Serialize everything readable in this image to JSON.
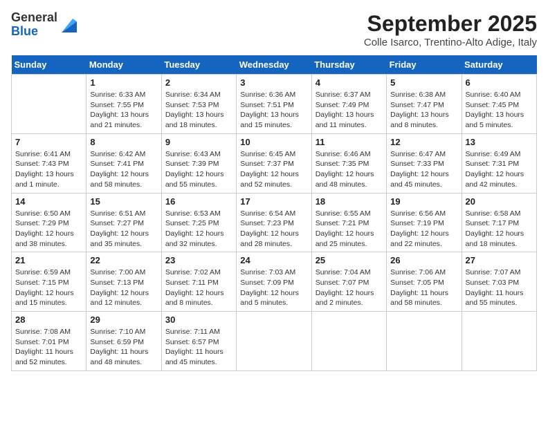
{
  "header": {
    "logo": {
      "general": "General",
      "blue": "Blue"
    },
    "title": "September 2025",
    "location": "Colle Isarco, Trentino-Alto Adige, Italy"
  },
  "calendar": {
    "weekdays": [
      "Sunday",
      "Monday",
      "Tuesday",
      "Wednesday",
      "Thursday",
      "Friday",
      "Saturday"
    ],
    "weeks": [
      [
        {
          "day": "",
          "sunrise": "",
          "sunset": "",
          "daylight": ""
        },
        {
          "day": "1",
          "sunrise": "Sunrise: 6:33 AM",
          "sunset": "Sunset: 7:55 PM",
          "daylight": "Daylight: 13 hours and 21 minutes."
        },
        {
          "day": "2",
          "sunrise": "Sunrise: 6:34 AM",
          "sunset": "Sunset: 7:53 PM",
          "daylight": "Daylight: 13 hours and 18 minutes."
        },
        {
          "day": "3",
          "sunrise": "Sunrise: 6:36 AM",
          "sunset": "Sunset: 7:51 PM",
          "daylight": "Daylight: 13 hours and 15 minutes."
        },
        {
          "day": "4",
          "sunrise": "Sunrise: 6:37 AM",
          "sunset": "Sunset: 7:49 PM",
          "daylight": "Daylight: 13 hours and 11 minutes."
        },
        {
          "day": "5",
          "sunrise": "Sunrise: 6:38 AM",
          "sunset": "Sunset: 7:47 PM",
          "daylight": "Daylight: 13 hours and 8 minutes."
        },
        {
          "day": "6",
          "sunrise": "Sunrise: 6:40 AM",
          "sunset": "Sunset: 7:45 PM",
          "daylight": "Daylight: 13 hours and 5 minutes."
        }
      ],
      [
        {
          "day": "7",
          "sunrise": "Sunrise: 6:41 AM",
          "sunset": "Sunset: 7:43 PM",
          "daylight": "Daylight: 13 hours and 1 minute."
        },
        {
          "day": "8",
          "sunrise": "Sunrise: 6:42 AM",
          "sunset": "Sunset: 7:41 PM",
          "daylight": "Daylight: 12 hours and 58 minutes."
        },
        {
          "day": "9",
          "sunrise": "Sunrise: 6:43 AM",
          "sunset": "Sunset: 7:39 PM",
          "daylight": "Daylight: 12 hours and 55 minutes."
        },
        {
          "day": "10",
          "sunrise": "Sunrise: 6:45 AM",
          "sunset": "Sunset: 7:37 PM",
          "daylight": "Daylight: 12 hours and 52 minutes."
        },
        {
          "day": "11",
          "sunrise": "Sunrise: 6:46 AM",
          "sunset": "Sunset: 7:35 PM",
          "daylight": "Daylight: 12 hours and 48 minutes."
        },
        {
          "day": "12",
          "sunrise": "Sunrise: 6:47 AM",
          "sunset": "Sunset: 7:33 PM",
          "daylight": "Daylight: 12 hours and 45 minutes."
        },
        {
          "day": "13",
          "sunrise": "Sunrise: 6:49 AM",
          "sunset": "Sunset: 7:31 PM",
          "daylight": "Daylight: 12 hours and 42 minutes."
        }
      ],
      [
        {
          "day": "14",
          "sunrise": "Sunrise: 6:50 AM",
          "sunset": "Sunset: 7:29 PM",
          "daylight": "Daylight: 12 hours and 38 minutes."
        },
        {
          "day": "15",
          "sunrise": "Sunrise: 6:51 AM",
          "sunset": "Sunset: 7:27 PM",
          "daylight": "Daylight: 12 hours and 35 minutes."
        },
        {
          "day": "16",
          "sunrise": "Sunrise: 6:53 AM",
          "sunset": "Sunset: 7:25 PM",
          "daylight": "Daylight: 12 hours and 32 minutes."
        },
        {
          "day": "17",
          "sunrise": "Sunrise: 6:54 AM",
          "sunset": "Sunset: 7:23 PM",
          "daylight": "Daylight: 12 hours and 28 minutes."
        },
        {
          "day": "18",
          "sunrise": "Sunrise: 6:55 AM",
          "sunset": "Sunset: 7:21 PM",
          "daylight": "Daylight: 12 hours and 25 minutes."
        },
        {
          "day": "19",
          "sunrise": "Sunrise: 6:56 AM",
          "sunset": "Sunset: 7:19 PM",
          "daylight": "Daylight: 12 hours and 22 minutes."
        },
        {
          "day": "20",
          "sunrise": "Sunrise: 6:58 AM",
          "sunset": "Sunset: 7:17 PM",
          "daylight": "Daylight: 12 hours and 18 minutes."
        }
      ],
      [
        {
          "day": "21",
          "sunrise": "Sunrise: 6:59 AM",
          "sunset": "Sunset: 7:15 PM",
          "daylight": "Daylight: 12 hours and 15 minutes."
        },
        {
          "day": "22",
          "sunrise": "Sunrise: 7:00 AM",
          "sunset": "Sunset: 7:13 PM",
          "daylight": "Daylight: 12 hours and 12 minutes."
        },
        {
          "day": "23",
          "sunrise": "Sunrise: 7:02 AM",
          "sunset": "Sunset: 7:11 PM",
          "daylight": "Daylight: 12 hours and 8 minutes."
        },
        {
          "day": "24",
          "sunrise": "Sunrise: 7:03 AM",
          "sunset": "Sunset: 7:09 PM",
          "daylight": "Daylight: 12 hours and 5 minutes."
        },
        {
          "day": "25",
          "sunrise": "Sunrise: 7:04 AM",
          "sunset": "Sunset: 7:07 PM",
          "daylight": "Daylight: 12 hours and 2 minutes."
        },
        {
          "day": "26",
          "sunrise": "Sunrise: 7:06 AM",
          "sunset": "Sunset: 7:05 PM",
          "daylight": "Daylight: 11 hours and 58 minutes."
        },
        {
          "day": "27",
          "sunrise": "Sunrise: 7:07 AM",
          "sunset": "Sunset: 7:03 PM",
          "daylight": "Daylight: 11 hours and 55 minutes."
        }
      ],
      [
        {
          "day": "28",
          "sunrise": "Sunrise: 7:08 AM",
          "sunset": "Sunset: 7:01 PM",
          "daylight": "Daylight: 11 hours and 52 minutes."
        },
        {
          "day": "29",
          "sunrise": "Sunrise: 7:10 AM",
          "sunset": "Sunset: 6:59 PM",
          "daylight": "Daylight: 11 hours and 48 minutes."
        },
        {
          "day": "30",
          "sunrise": "Sunrise: 7:11 AM",
          "sunset": "Sunset: 6:57 PM",
          "daylight": "Daylight: 11 hours and 45 minutes."
        },
        {
          "day": "",
          "sunrise": "",
          "sunset": "",
          "daylight": ""
        },
        {
          "day": "",
          "sunrise": "",
          "sunset": "",
          "daylight": ""
        },
        {
          "day": "",
          "sunrise": "",
          "sunset": "",
          "daylight": ""
        },
        {
          "day": "",
          "sunrise": "",
          "sunset": "",
          "daylight": ""
        }
      ]
    ]
  }
}
